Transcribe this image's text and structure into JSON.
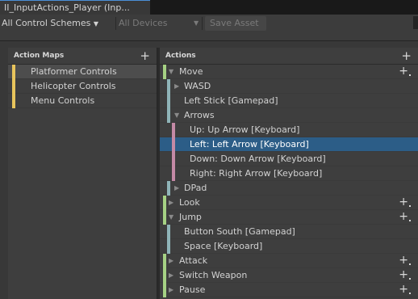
{
  "window": {
    "tab_title": "II_InputActions_Player (Inp..."
  },
  "toolbar": {
    "control_schemes": "All Control Schemes",
    "control_schemes_arrow": "▼",
    "devices": "All Devices",
    "devices_arrow": "▼",
    "save_asset": "Save Asset"
  },
  "action_maps": {
    "header": "Action Maps",
    "add_icon": "+",
    "items": [
      {
        "label": "Platformer Controls",
        "selected": true
      },
      {
        "label": "Helicopter Controls",
        "selected": false
      },
      {
        "label": "Menu Controls",
        "selected": false
      }
    ]
  },
  "actions": {
    "header": "Actions",
    "add_icon": "+",
    "rows": [
      {
        "label": "Move",
        "kind": "action",
        "expanded": true
      },
      {
        "label": "WASD",
        "kind": "composite",
        "expanded": false
      },
      {
        "label": "Left Stick [Gamepad]",
        "kind": "binding"
      },
      {
        "label": "Arrows",
        "kind": "composite",
        "expanded": true
      },
      {
        "label": "Up: Up Arrow [Keyboard]",
        "kind": "part"
      },
      {
        "label": "Left: Left Arrow [Keyboard]",
        "kind": "part",
        "selected": true
      },
      {
        "label": "Down: Down Arrow [Keyboard]",
        "kind": "part"
      },
      {
        "label": "Right: Right Arrow [Keyboard]",
        "kind": "part"
      },
      {
        "label": "DPad",
        "kind": "composite",
        "expanded": false
      },
      {
        "label": "Look",
        "kind": "action",
        "expanded": false
      },
      {
        "label": "Jump",
        "kind": "action",
        "expanded": true
      },
      {
        "label": "Button South [Gamepad]",
        "kind": "binding"
      },
      {
        "label": "Space [Keyboard]",
        "kind": "binding"
      },
      {
        "label": "Attack",
        "kind": "action",
        "expanded": false
      },
      {
        "label": "Switch Weapon",
        "kind": "action",
        "expanded": false
      },
      {
        "label": "Pause",
        "kind": "action",
        "expanded": false
      }
    ]
  },
  "colors": {
    "map_stripe": "#e8c45c",
    "action_stripe": "#a6d284",
    "binding_stripe": "#8fb4b8",
    "part_stripe": "#c48aa6",
    "selection": "#2c5d87"
  }
}
